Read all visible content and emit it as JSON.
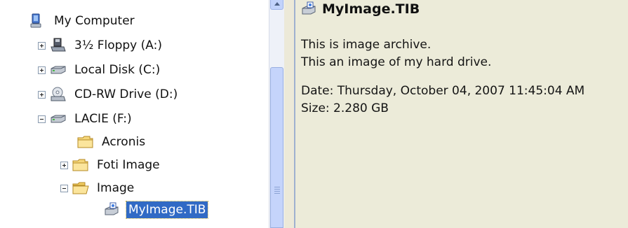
{
  "tree": {
    "items": [
      {
        "label": "My Computer",
        "icon": "computer-icon",
        "expander": "none"
      },
      {
        "label": "3½ Floppy (A:)",
        "icon": "floppy-drive-icon",
        "expander": "plus"
      },
      {
        "label": "Local Disk (C:)",
        "icon": "hard-disk-icon",
        "expander": "plus"
      },
      {
        "label": "CD-RW Drive (D:)",
        "icon": "cd-drive-icon",
        "expander": "plus"
      },
      {
        "label": "LACIE (F:)",
        "icon": "hard-disk-icon",
        "expander": "minus"
      },
      {
        "label": "Acronis",
        "icon": "folder-icon",
        "expander": "none"
      },
      {
        "label": "Foti Image",
        "icon": "folder-icon",
        "expander": "plus"
      },
      {
        "label": "Image",
        "icon": "folder-icon",
        "expander": "minus"
      },
      {
        "label": "MyImage.TIB",
        "icon": "image-archive-icon",
        "expander": "none",
        "selected": true
      }
    ]
  },
  "details": {
    "title": "MyImage.TIB",
    "title_icon": "image-archive-icon",
    "line1": "This is image archive.",
    "line2": "This an image of my hard drive.",
    "date": "Date: Thursday, October 04, 2007 11:45:04 AM",
    "size": "Size: 2.280 GB"
  },
  "colors": {
    "selection": "#316ac5",
    "details_bg": "#ecebd9",
    "scrollbar_thumb": "#c5d4fb"
  }
}
